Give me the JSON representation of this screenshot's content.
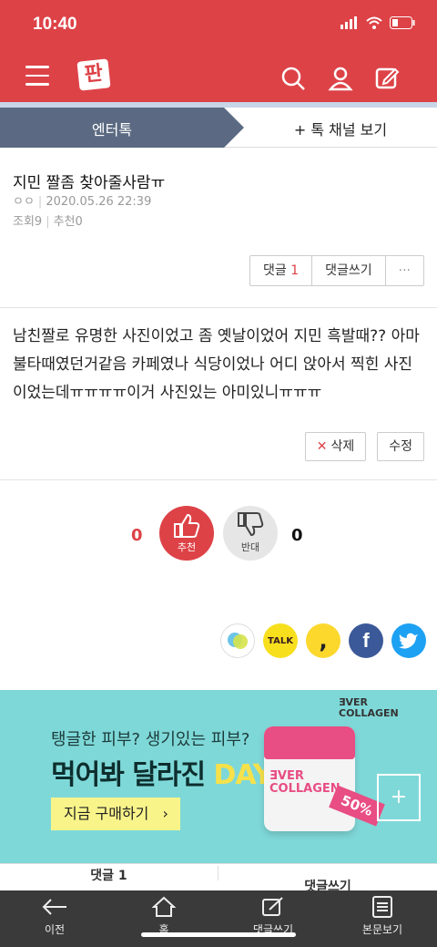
{
  "status": {
    "time": "10:40"
  },
  "header": {
    "logo": "판"
  },
  "tabs": {
    "active": "엔터톡",
    "other": "+ 톡 채널 보기"
  },
  "post": {
    "title": "지민 짤좀 찾아줄사람ㅠ",
    "author": "ㅇㅇ",
    "date": "2020.05.26 22:39",
    "views_label": "조회",
    "views": "9",
    "recommend_label": "추천",
    "recommend": "0",
    "body": "남친짤로 유명한 사진이었고 좀 옛날이었어 지민 흑발때?? 아마 불타때였던거같음 카페였나 식당이었나 어디 앉아서 찍힌 사진이었는데ㅠㅠㅠㅠ이거 사진있는 아미있니ㅠㅠㅠ"
  },
  "buttons": {
    "comment_label": "댓글",
    "comment_count": "1",
    "write_comment": "댓글쓰기",
    "more": "···",
    "delete": "삭제",
    "edit": "수정"
  },
  "vote": {
    "up_count": "0",
    "up_label": "추천",
    "down_label": "반대",
    "down_count": "0"
  },
  "share": {
    "kakaotalk": "TALK"
  },
  "ad": {
    "line1": "탱글한 피부? 생기있는 피부?",
    "line2": "먹어봐 달라진 ",
    "line2_day": "DAY",
    "cta": "지금 구매하기",
    "brand": "ƎVER\nCOLLAGEN",
    "jar_name": "ƎVER\nCOLLAGEN",
    "tag": "50%"
  },
  "comment_bar": {
    "left": "댓글 1",
    "right": "댓글쓰기"
  },
  "bottom_nav": [
    {
      "label": "이전"
    },
    {
      "label": "홈"
    },
    {
      "label": "댓글쓰기"
    },
    {
      "label": "본문보기"
    }
  ],
  "colors": {
    "brand": "#dd4247",
    "tab_active": "#5b6a82",
    "ad_bg": "#7fd8d8"
  }
}
